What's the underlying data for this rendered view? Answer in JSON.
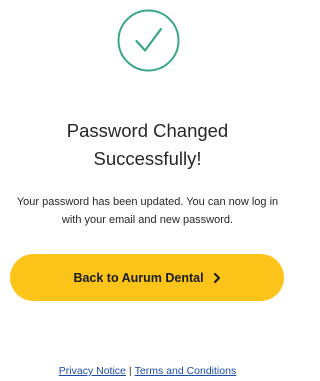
{
  "status_icon": "check-circle-icon",
  "colors": {
    "success": "#3aa68a",
    "button_bg": "#fcc419",
    "link": "#1c4aa8"
  },
  "title": {
    "line1": "Password Changed",
    "line2": "Successfully!"
  },
  "message": "Your password has been updated. You can now log in with your email and new password.",
  "back_button": {
    "label": "Back to Aurum Dental",
    "icon": "chevron-right-icon"
  },
  "footer": {
    "privacy_label": "Privacy Notice",
    "separator": "|",
    "terms_label": "Terms and Conditions"
  }
}
